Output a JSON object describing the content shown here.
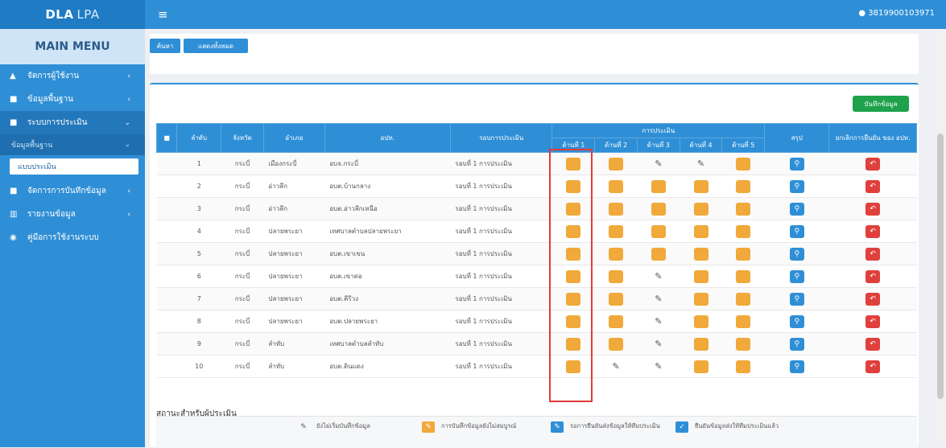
{
  "app": {
    "brand": "DLA",
    "brand_suffix": "LPA",
    "user_id": "3819900103971"
  },
  "sidebar": {
    "menu_title": "MAIN MENU",
    "items": [
      {
        "label": "จัดการผู้ใช้งาน",
        "icon": "user-icon"
      },
      {
        "label": "ข้อมูลพื้นฐาน",
        "icon": "book-icon"
      },
      {
        "label": "ระบบการประเมิน",
        "icon": "book-icon"
      }
    ],
    "sub": {
      "label": "ข้อมูลพื้นฐาน"
    },
    "subsub": {
      "label": "แบบประเมิน"
    },
    "items2": [
      {
        "label": "จัดการการบันทึกข้อมูล",
        "icon": "book-icon"
      },
      {
        "label": "รายงานข้อมูล",
        "icon": "chart-icon"
      },
      {
        "label": "คู่มือการใช้งานระบบ",
        "icon": "globe-icon"
      }
    ]
  },
  "toolbar": {
    "tab1": "ค้นหา",
    "tab2": "แสดงทั้งหมด"
  },
  "save_button": "บันทึกข้อมูล",
  "table": {
    "headers": {
      "check": "■",
      "no": "ลำดับ",
      "province": "จังหวัด",
      "district": "อำเภอ",
      "org": "อปท.",
      "round": "รอบการประเมิน",
      "assessment": "การประเมิน",
      "d1": "ด้านที่ 1",
      "d2": "ด้านที่ 2",
      "d3": "ด้านที่ 3",
      "d4": "ด้านที่ 4",
      "d5": "ด้านที่ 5",
      "summary": "สรุป",
      "cancel": "ยกเลิกการยืนยัน ของ อปท."
    },
    "rows": [
      {
        "no": "1",
        "province": "กระบี่",
        "district": "เมืองกระบี่",
        "org": "อบจ.กระบี่",
        "round": "รอบที่ 1 การประเมิน",
        "d": [
          "orange",
          "orange",
          "edit",
          "edit",
          "orange"
        ]
      },
      {
        "no": "2",
        "province": "กระบี่",
        "district": "อ่าวลึก",
        "org": "อบต.บ้านกลาง",
        "round": "รอบที่ 1 การประเมิน",
        "d": [
          "orange",
          "orange",
          "orange",
          "orange",
          "orange"
        ]
      },
      {
        "no": "3",
        "province": "กระบี่",
        "district": "อ่าวลึก",
        "org": "อบต.อ่าวลึกเหนือ",
        "round": "รอบที่ 1 การประเมิน",
        "d": [
          "orange",
          "orange",
          "orange",
          "orange",
          "orange"
        ]
      },
      {
        "no": "4",
        "province": "กระบี่",
        "district": "ปลายพระยา",
        "org": "เทศบาลตำบลปลายพระยา",
        "round": "รอบที่ 1 การประเมิน",
        "d": [
          "orange",
          "orange",
          "orange",
          "orange",
          "orange"
        ]
      },
      {
        "no": "5",
        "province": "กระบี่",
        "district": "ปลายพระยา",
        "org": "อบต.เขาเขน",
        "round": "รอบที่ 1 การประเมิน",
        "d": [
          "orange",
          "orange",
          "orange",
          "orange",
          "orange"
        ]
      },
      {
        "no": "6",
        "province": "กระบี่",
        "district": "ปลายพระยา",
        "org": "อบต.เขาต่อ",
        "round": "รอบที่ 1 การประเมิน",
        "d": [
          "orange",
          "orange",
          "edit",
          "orange",
          "orange"
        ]
      },
      {
        "no": "7",
        "province": "กระบี่",
        "district": "ปลายพระยา",
        "org": "อบต.คีรีวง",
        "round": "รอบที่ 1 การประเมิน",
        "d": [
          "orange",
          "orange",
          "edit",
          "orange",
          "orange"
        ]
      },
      {
        "no": "8",
        "province": "กระบี่",
        "district": "ปลายพระยา",
        "org": "อบต.ปลายพระยา",
        "round": "รอบที่ 1 การประเมิน",
        "d": [
          "orange",
          "orange",
          "edit",
          "orange",
          "orange"
        ]
      },
      {
        "no": "9",
        "province": "กระบี่",
        "district": "ลำทับ",
        "org": "เทศบาลตำบลลำทับ",
        "round": "รอบที่ 1 การประเมิน",
        "d": [
          "orange",
          "orange",
          "edit",
          "orange",
          "orange"
        ]
      },
      {
        "no": "10",
        "province": "กระบี่",
        "district": "ลำทับ",
        "org": "อบต.ดินแดง",
        "round": "รอบที่ 1 การประเมิน",
        "d": [
          "orange",
          "edit",
          "edit",
          "orange",
          "orange"
        ]
      }
    ]
  },
  "legend": {
    "title": "สถานะสำหรับผู้ประเมิน",
    "items": [
      {
        "text": "ยังไม่เริ่มบันทึกข้อมูล",
        "color": "#ffffff"
      },
      {
        "text": "การบันทึกข้อมูลยังไม่สมบูรณ์",
        "color": "#f0a93a"
      },
      {
        "text": "รอการยืนยันส่งข้อมูลให้ทีมประเมิน",
        "color": "#2f8fd6"
      },
      {
        "text": "ยืนยันข้อมูลส่งให้ทีมประเมินแล้ว",
        "color": "#2f8fd6"
      }
    ]
  }
}
